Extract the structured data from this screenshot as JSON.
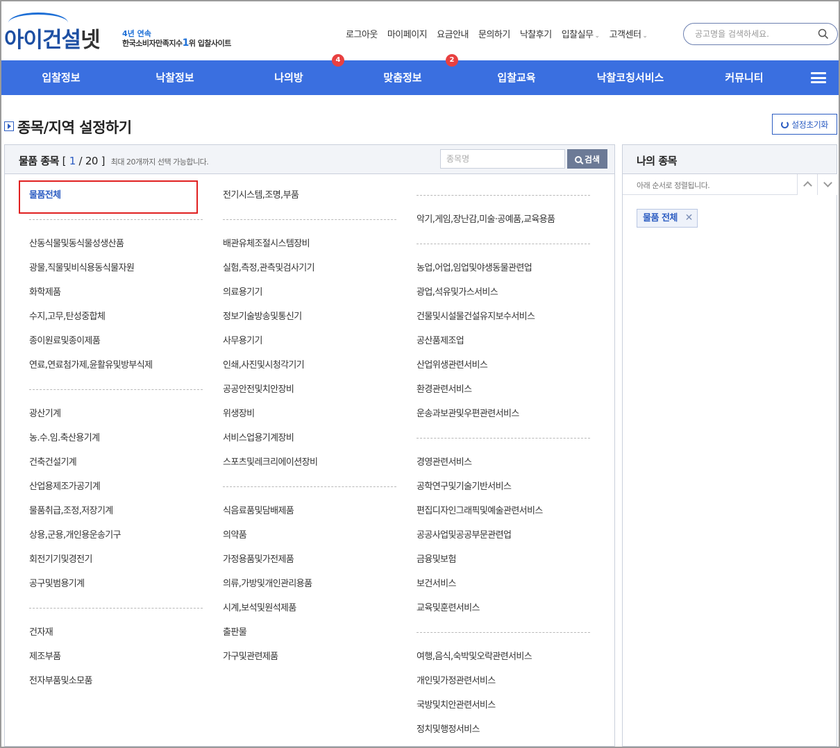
{
  "header": {
    "logo_main_a": "아이건설",
    "logo_main_b": "넷",
    "logo_sub1": "4년 연속",
    "logo_sub2_a": "한국소비자만족지수",
    "logo_sub2_rank": "1",
    "logo_sub2_b": "위 입찰사이트",
    "topnav": [
      "로그아웃",
      "마이페이지",
      "요금안내",
      "문의하기",
      "낙찰후기",
      "입찰실무",
      "고객센터"
    ],
    "search_placeholder": "공고명을 검색하세요."
  },
  "mainnav": {
    "items": [
      "입찰정보",
      "낙찰정보",
      "나의방",
      "맞춤정보",
      "입찰교육",
      "낙찰코칭서비스",
      "커뮤니티"
    ],
    "badge_mine": "4",
    "badge_custom": "2"
  },
  "page": {
    "title": "종목/지역 설정하기",
    "reset_label": "설정초기화"
  },
  "left": {
    "title": "물품 종목",
    "count_open": "[",
    "count_current": "1",
    "count_sep": "/",
    "count_max": "20",
    "count_close": "]",
    "note": "최대 20개까지 선택 가능합니다.",
    "search_placeholder": "종목명",
    "search_button": "검색",
    "col1": [
      "물품전체",
      "",
      "산동식물및동식물성생산품",
      "광물,직물및비식용동식물자원",
      "화학제품",
      "수지,고무,탄성중합체",
      "종이원료및종이제품",
      "연료,연료첨가제,윤활유및방부식제",
      "",
      "광산기계",
      "농.수.임.축산용기계",
      "건축건설기계",
      "산업용제조가공기계",
      "물품취급,조정,저장기계",
      "상용,군용,개인용운송기구",
      "회전기기및경전기",
      "공구및범용기계",
      "",
      "건자재",
      "제조부품",
      "전자부품및소모품"
    ],
    "col2": [
      "전기시스템,조명,부품",
      "",
      "배관유체조절시스템장비",
      "실험,측정,관측및검사기기",
      "의료용기기",
      "정보기술방송및통신기",
      "사무용기기",
      "인쇄,사진및시청각기기",
      "공공안전및치안장비",
      "위생장비",
      "서비스업용기계장비",
      "스포츠및레크리에이션장비",
      "",
      "식음료품및담배제품",
      "의약품",
      "가정용품및가전제품",
      "의류,가방및개인관리용품",
      "시계,보석및원석제품",
      "출판물",
      "가구및관련제품"
    ],
    "col3": [
      "",
      "악기,게임,장난감,미술·공예품,교육용품",
      "",
      "농업,어업,임업및야생동물관련업",
      "광업,석유및가스서비스",
      "건물및시설물건설유지보수서비스",
      "공산품제조업",
      "산업위생관련서비스",
      "환경관련서비스",
      "운송과보관및우편관련서비스",
      "",
      "경영관련서비스",
      "공학연구및기술기반서비스",
      "편집디자인그래픽및예술관련서비스",
      "공공사업및공공부문관련업",
      "금융및보험",
      "보건서비스",
      "교육및훈련서비스",
      "",
      "여행,음식,숙박및오락관련서비스",
      "개인및가정관련서비스",
      "국방및치안관련서비스",
      "정치및행정서비스"
    ]
  },
  "right": {
    "title": "나의 종목",
    "sub": "아래 순서로 정렬됩니다.",
    "chip_label": "물품 전체",
    "chip_remove": "✕"
  },
  "colors": {
    "nav": "#3a6fe0",
    "accent": "#2b5cc2",
    "badge": "#e84040",
    "highlight_box": "#e02020"
  },
  "icons": [
    "search-icon",
    "hamburger-icon",
    "reset-icon",
    "title-bullet-icon",
    "chevron-up-icon",
    "chevron-down-icon",
    "close-icon"
  ]
}
